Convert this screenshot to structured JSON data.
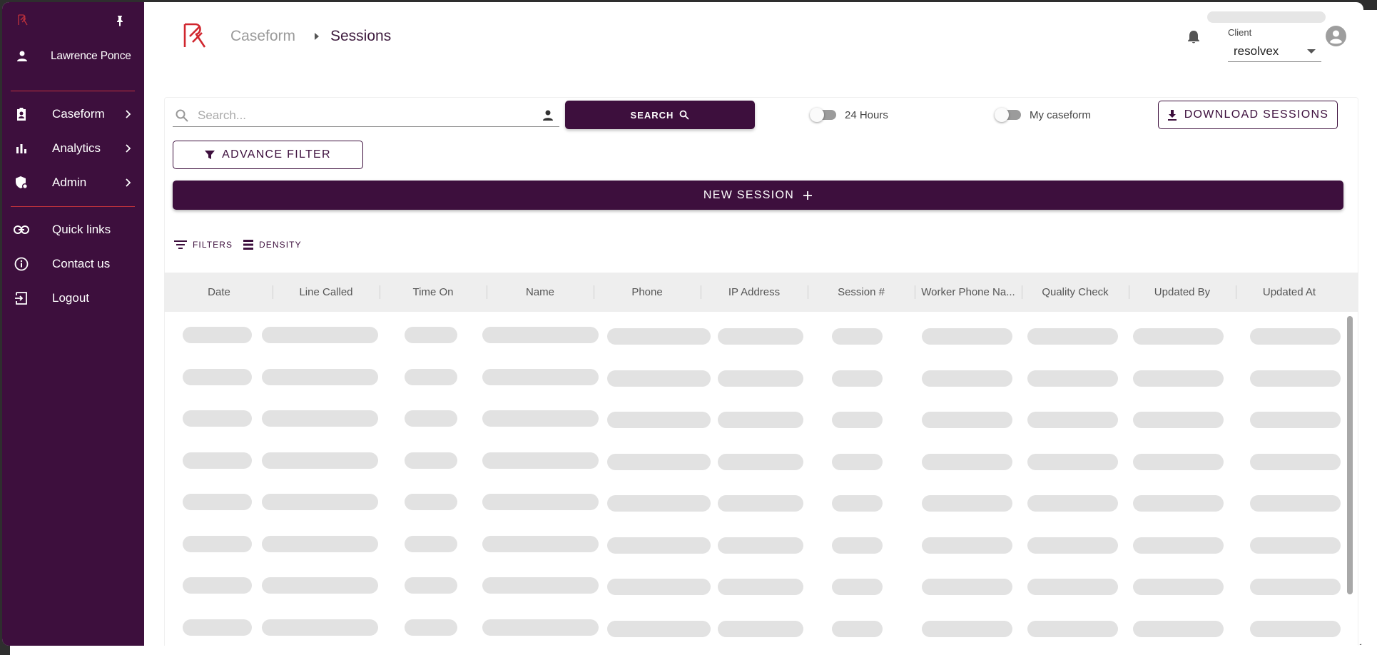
{
  "sidebar": {
    "user_name": "Lawrence Ponce",
    "items": [
      {
        "label": "Caseform",
        "icon": "clipboard-user-icon",
        "has_chevron": true
      },
      {
        "label": "Analytics",
        "icon": "bar-chart-icon",
        "has_chevron": true
      },
      {
        "label": "Admin",
        "icon": "shield-lock-icon",
        "has_chevron": true
      },
      {
        "label": "Quick links",
        "icon": "link-icon",
        "has_chevron": false
      },
      {
        "label": "Contact us",
        "icon": "info-icon",
        "has_chevron": false
      },
      {
        "label": "Logout",
        "icon": "logout-icon",
        "has_chevron": false
      }
    ]
  },
  "header": {
    "breadcrumb": [
      "Caseform",
      "Sessions"
    ],
    "client_label": "Client",
    "client_value": "resolvex"
  },
  "toolbar": {
    "search_placeholder": "Search...",
    "search_button": "SEARCH",
    "toggle_24h": "24 Hours",
    "toggle_my_caseform": "My caseform",
    "download_button": "DOWNLOAD SESSIONS",
    "advance_filter_button": "ADVANCE FILTER",
    "new_session_button": "NEW SESSION",
    "filters_label": "FILTERS",
    "density_label": "DENSITY"
  },
  "table": {
    "columns": [
      "Date",
      "Line Called",
      "Time On",
      "Name",
      "Phone",
      "IP Address",
      "Session #",
      "Worker Phone Na...",
      "Quality Check",
      "Updated By",
      "Updated At"
    ],
    "loading": true
  },
  "colors": {
    "brand": "#3d0f3d",
    "accent_red": "#c0323c"
  }
}
